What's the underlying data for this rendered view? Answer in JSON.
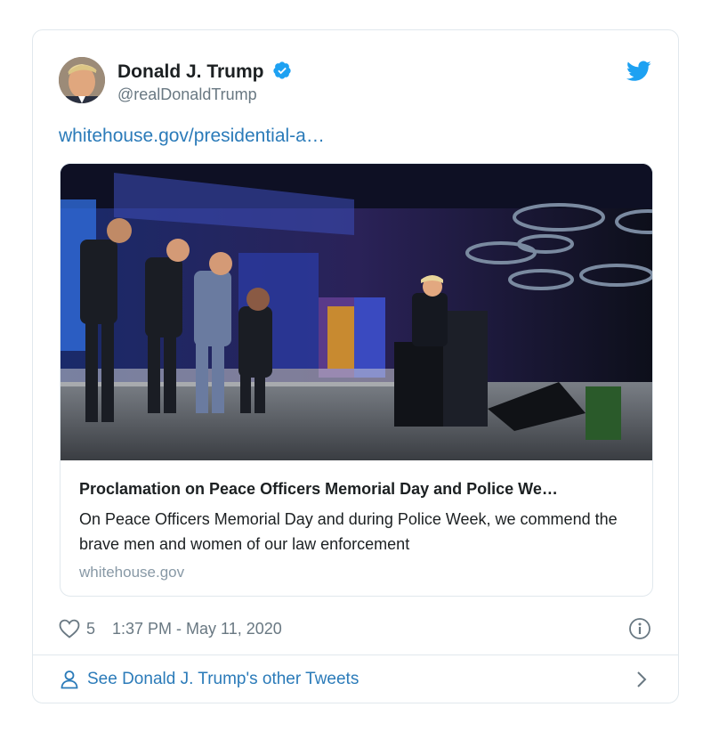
{
  "author": {
    "name": "Donald J. Trump",
    "handle": "@realDonaldTrump"
  },
  "tweet": {
    "link_text": "whitehouse.gov/presidential-a…"
  },
  "card": {
    "title": "Proclamation on Peace Officers Memorial Day and Police We…",
    "description": "On Peace Officers Memorial Day and during Police Week, we commend the brave men and women of our law enforcement",
    "domain": "whitehouse.gov"
  },
  "meta": {
    "like_count": "5",
    "timestamp": "1:37 PM - May 11, 2020"
  },
  "footer": {
    "link_text": "See Donald J. Trump's other Tweets"
  },
  "icons": {
    "verified": "verified-badge-icon",
    "brand": "twitter-bird-icon",
    "like": "heart-icon",
    "info": "info-icon",
    "person": "person-icon",
    "chevron": "chevron-right-icon"
  },
  "colors": {
    "brand_blue": "#1da1f2",
    "link_blue": "#2b7bb9",
    "muted_gray": "#697882",
    "border": "#e1e8ed"
  }
}
